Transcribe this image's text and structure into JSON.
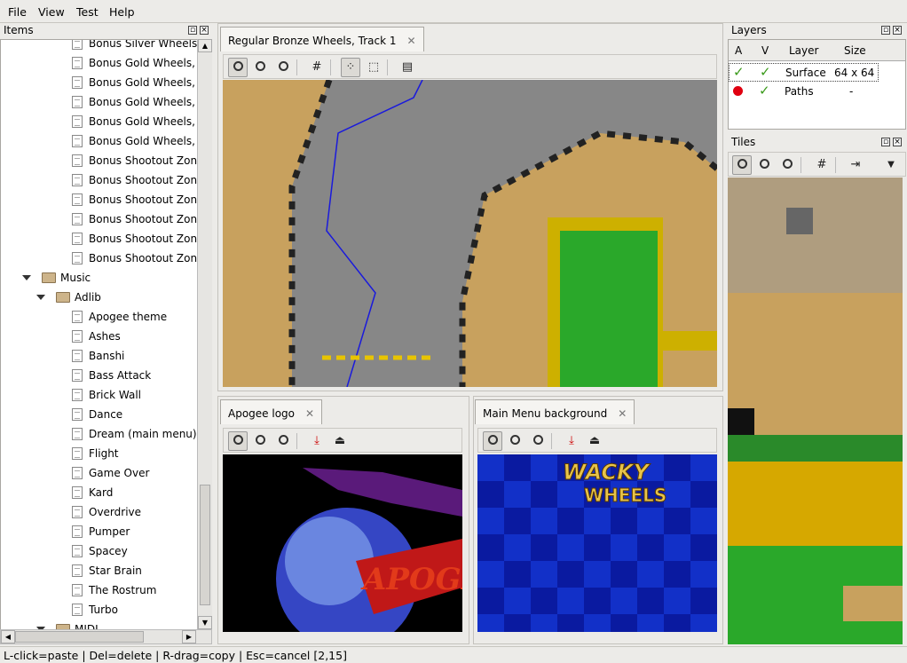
{
  "menu": {
    "file": "File",
    "view": "View",
    "test": "Test",
    "help": "Help"
  },
  "items_panel": {
    "title": "Items",
    "rows": [
      {
        "label": "Bonus Silver Wheels, ",
        "kind": "doc",
        "indent": 2
      },
      {
        "label": "Bonus Gold Wheels, T",
        "kind": "doc",
        "indent": 2
      },
      {
        "label": "Bonus Gold Wheels, T",
        "kind": "doc",
        "indent": 2
      },
      {
        "label": "Bonus Gold Wheels, T",
        "kind": "doc",
        "indent": 2
      },
      {
        "label": "Bonus Gold Wheels, T",
        "kind": "doc",
        "indent": 2
      },
      {
        "label": "Bonus Gold Wheels, F",
        "kind": "doc",
        "indent": 2
      },
      {
        "label": "Bonus Shootout Zone",
        "kind": "doc",
        "indent": 2
      },
      {
        "label": "Bonus Shootout Zone",
        "kind": "doc",
        "indent": 2
      },
      {
        "label": "Bonus Shootout Zone",
        "kind": "doc",
        "indent": 2
      },
      {
        "label": "Bonus Shootout Zone",
        "kind": "doc",
        "indent": 2
      },
      {
        "label": "Bonus Shootout Zone",
        "kind": "doc",
        "indent": 2
      },
      {
        "label": "Bonus Shootout Zone",
        "kind": "doc",
        "indent": 2
      },
      {
        "label": "Music",
        "kind": "folder",
        "indent": 0
      },
      {
        "label": "Adlib",
        "kind": "folder",
        "indent": 1
      },
      {
        "label": "Apogee theme",
        "kind": "doc",
        "indent": 2
      },
      {
        "label": "Ashes",
        "kind": "doc",
        "indent": 2
      },
      {
        "label": "Banshi",
        "kind": "doc",
        "indent": 2
      },
      {
        "label": "Bass Attack",
        "kind": "doc",
        "indent": 2
      },
      {
        "label": "Brick Wall",
        "kind": "doc",
        "indent": 2
      },
      {
        "label": "Dance",
        "kind": "doc",
        "indent": 2
      },
      {
        "label": "Dream (main menu)",
        "kind": "doc",
        "indent": 2
      },
      {
        "label": "Flight",
        "kind": "doc",
        "indent": 2
      },
      {
        "label": "Game Over",
        "kind": "doc",
        "indent": 2
      },
      {
        "label": "Kard",
        "kind": "doc",
        "indent": 2
      },
      {
        "label": "Overdrive",
        "kind": "doc",
        "indent": 2
      },
      {
        "label": "Pumper",
        "kind": "doc",
        "indent": 2
      },
      {
        "label": "Spacey",
        "kind": "doc",
        "indent": 2
      },
      {
        "label": "Star Brain",
        "kind": "doc",
        "indent": 2
      },
      {
        "label": "The Rostrum",
        "kind": "doc",
        "indent": 2
      },
      {
        "label": "Turbo",
        "kind": "doc",
        "indent": 2
      },
      {
        "label": "MIDI",
        "kind": "folder",
        "indent": 1
      }
    ]
  },
  "tabs": {
    "track": "Regular Bronze Wheels, Track 1",
    "logo": "Apogee logo",
    "menu_bg": "Main Menu background",
    "close": "✕"
  },
  "logo_text": "APOGEE",
  "menu_bg_text": {
    "line1": "WACKY",
    "line2": "WHEELS"
  },
  "layers": {
    "title": "Layers",
    "headers": [
      "A",
      "V",
      "Layer",
      "Size"
    ],
    "rows": [
      {
        "a": "check",
        "v": "check",
        "layer": "Surface",
        "size": "64 x 64"
      },
      {
        "a": "dot",
        "v": "check",
        "layer": "Paths",
        "size": "-"
      }
    ]
  },
  "tiles": {
    "title": "Tiles"
  },
  "status": "L-click=paste | Del=delete | R-drag=copy | Esc=cancel [2,15]"
}
